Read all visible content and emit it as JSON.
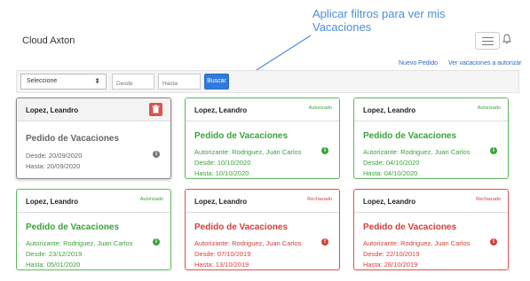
{
  "app": {
    "brand": "Cloud Axton"
  },
  "callout": {
    "text": "Aplicar filtros para ver mis Vacaciones",
    "color": "#4a8fd6"
  },
  "icons": {
    "menu": "hamburger-menu-icon",
    "notifications": "bell-icon",
    "delete": "trash-icon",
    "info": "info-circle-icon",
    "dropdown": "chevron-down-icon"
  },
  "links": {
    "new_request": "Nuevo Pedido",
    "authorize": "Ver vacaciones a autorizar"
  },
  "filters": {
    "select_value": "Seleccione",
    "from_placeholder": "Desde",
    "to_placeholder": "Hasta",
    "search_label": "Buscar"
  },
  "colors": {
    "approved": "#5cb85c",
    "rejected": "#d9534f",
    "primary": "#2f7be0",
    "pending": "#888888"
  },
  "cards": [
    {
      "name": "Lopez, Leandro",
      "status": "",
      "title": "Pedido de Vacaciones",
      "authorizer": "",
      "from": "Desde: 20/09/2020",
      "to": "Hasta: 20/09/2020"
    },
    {
      "name": "Lopez, Leandro",
      "status": "Autorizado",
      "title": "Pedido de Vacaciones",
      "authorizer": "Autorizante: Rodriguez, Juan Carlos",
      "from": "Desde: 10/10/2020",
      "to": "Hasta: 10/10/2020"
    },
    {
      "name": "Lopez, Leandro",
      "status": "Autorizado",
      "title": "Pedido de Vacaciones",
      "authorizer": "Autorizante: Rodriguez, Juan Carlos",
      "from": "Desde: 04/10/2020",
      "to": "Hasta: 04/10/2020"
    },
    {
      "name": "Lopez, Leandro",
      "status": "Autorizado",
      "title": "Pedido de Vacaciones",
      "authorizer": "Autorizante: Rodriguez, Juan Carlos",
      "from": "Desde: 23/12/2019",
      "to": "Hasta: 05/01/2020"
    },
    {
      "name": "Lopez, Leandro",
      "status": "Rechazado",
      "title": "Pedido de Vacaciones",
      "authorizer": "Autorizante: Rodriguez, Juan Carlos",
      "from": "Desde: 07/10/2019",
      "to": "Hasta: 13/10/2019"
    },
    {
      "name": "Lopez, Leandro",
      "status": "Rechazado",
      "title": "Pedido de Vacaciones",
      "authorizer": "Autorizante: Rodriguez, Juan Carlos",
      "from": "Desde: 22/10/2019",
      "to": "Hasta: 28/10/2019"
    }
  ]
}
